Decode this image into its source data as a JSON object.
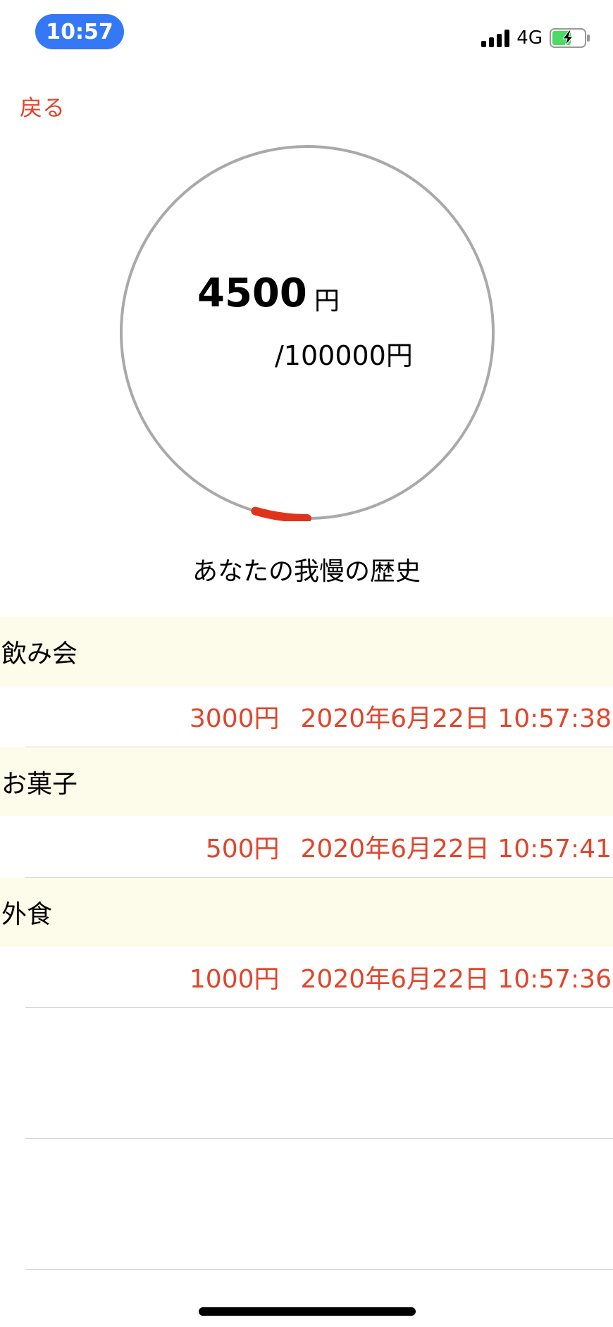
{
  "colors": {
    "accent": "#e0452b",
    "time_pill": "#3478f6",
    "ring_track": "#a9a9a9",
    "ring_progress": "#e0331b",
    "section_bg": "#fdfbea"
  },
  "status_bar": {
    "time": "10:57",
    "network": "4G",
    "icons": [
      "cellular-signal-icon",
      "battery-charging-icon"
    ]
  },
  "nav": {
    "back_label": "戻る"
  },
  "progress": {
    "current": "4500",
    "unit": "円",
    "goal_label": "/100000円",
    "fraction": 0.045
  },
  "history": {
    "title": "あなたの我慢の歴史",
    "sections": [
      {
        "category": "飲み会",
        "amount": "3000円",
        "timestamp": "2020年6月22日 10:57:38"
      },
      {
        "category": "お菓子",
        "amount": "500円",
        "timestamp": "2020年6月22日 10:57:41"
      },
      {
        "category": "外食",
        "amount": "1000円",
        "timestamp": "2020年6月22日 10:57:36"
      }
    ]
  }
}
